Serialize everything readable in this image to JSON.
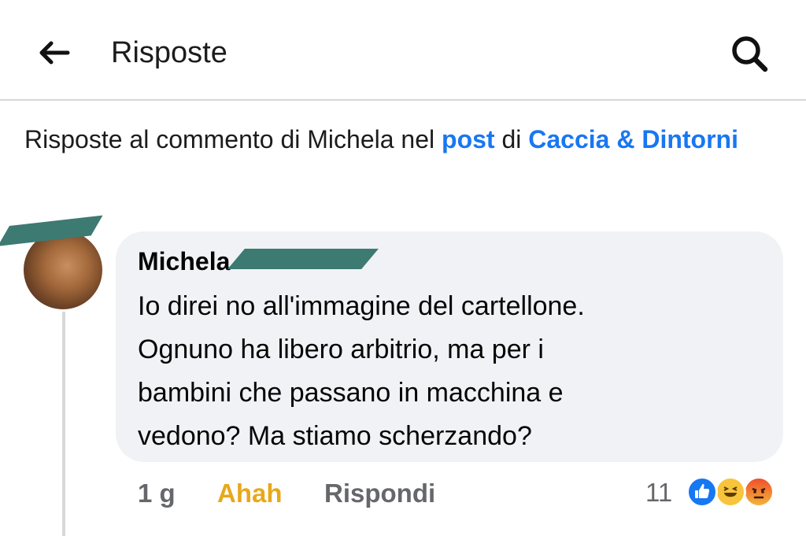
{
  "header": {
    "title": "Risposte",
    "back_icon": "arrow-left-icon",
    "search_icon": "search-icon"
  },
  "context": {
    "prefix": "Risposte al commento di Michela nel ",
    "post_link": "post",
    "middle": " di ",
    "group_link": "Caccia & Dintorni"
  },
  "comment": {
    "author": "Michela",
    "text": "Io direi no all'immagine del cartellone.\nOgnuno ha libero arbitrio, ma per i\nbambini che passano in macchina e\nvedono? Ma stiamo scherzando?",
    "time": "1 g",
    "reaction_label": "Ahah",
    "reply_label": "Rispondi",
    "reaction_count": "11",
    "reaction_icons": [
      "like-icon",
      "haha-icon",
      "angry-icon"
    ]
  },
  "colors": {
    "link": "#1877f2",
    "reaction_active": "#e8a81a",
    "meta": "#65676b",
    "bubble": "#f0f2f5"
  }
}
